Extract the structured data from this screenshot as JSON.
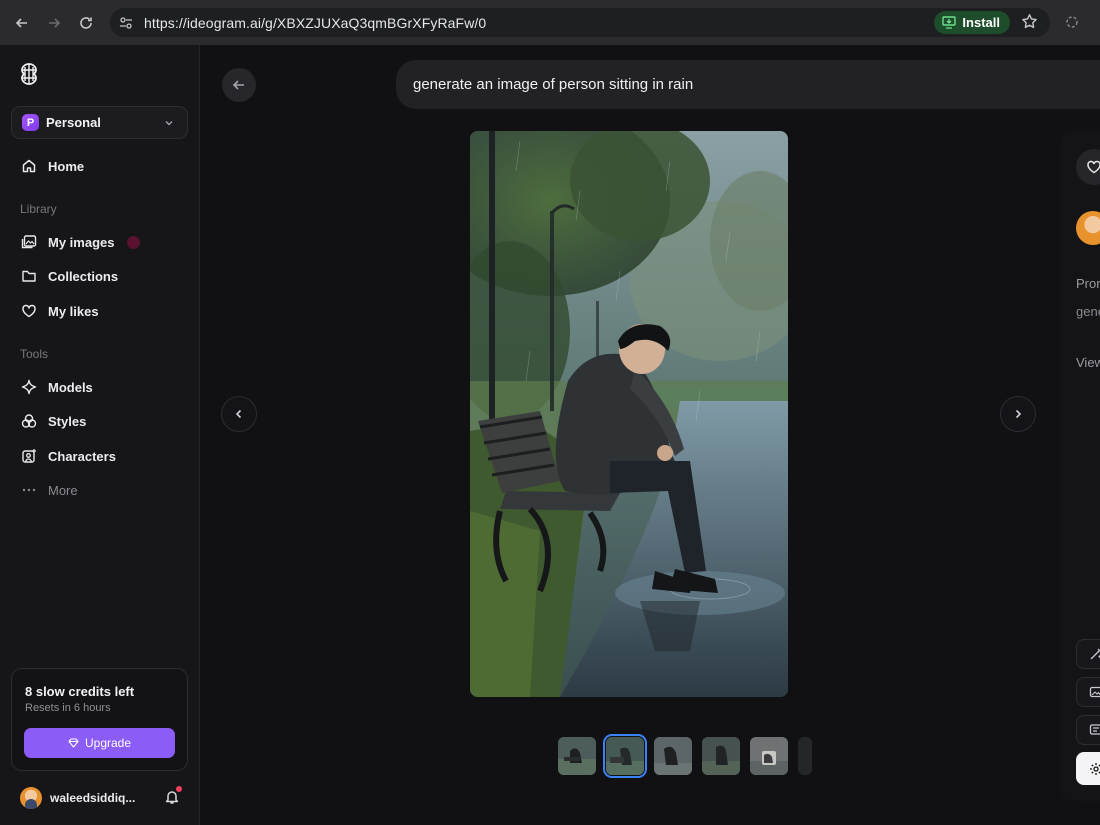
{
  "browser": {
    "url": "https://ideogram.ai/g/XBXZJUXaQ3qmBGrXFyRaFw/0",
    "install_label": "Install"
  },
  "sidebar": {
    "workspace": {
      "badge": "P",
      "name": "Personal"
    },
    "home_label": "Home",
    "library_heading": "Library",
    "library_items": [
      {
        "label": "My images",
        "icon": "images-icon"
      },
      {
        "label": "Collections",
        "icon": "folder-icon"
      },
      {
        "label": "My likes",
        "icon": "heart-icon"
      }
    ],
    "tools_heading": "Tools",
    "tools_items": [
      {
        "label": "Models",
        "icon": "sparkle-icon"
      },
      {
        "label": "Styles",
        "icon": "styles-icon"
      },
      {
        "label": "Characters",
        "icon": "character-icon"
      },
      {
        "label": "More",
        "icon": "more-icon"
      }
    ],
    "credits": {
      "title": "8 slow credits left",
      "subtitle": "Resets in 6 hours",
      "upgrade_label": "Upgrade"
    },
    "user": {
      "name": "waleedsiddiq..."
    }
  },
  "main": {
    "prompt": "generate an image of person sitting in rain",
    "thumbnail_count": 6,
    "selected_thumbnail": 2
  },
  "right_panel": {
    "prompt_label_partial": "Pror",
    "prompt_value_partial": "gene",
    "view_label_partial": "View"
  }
}
